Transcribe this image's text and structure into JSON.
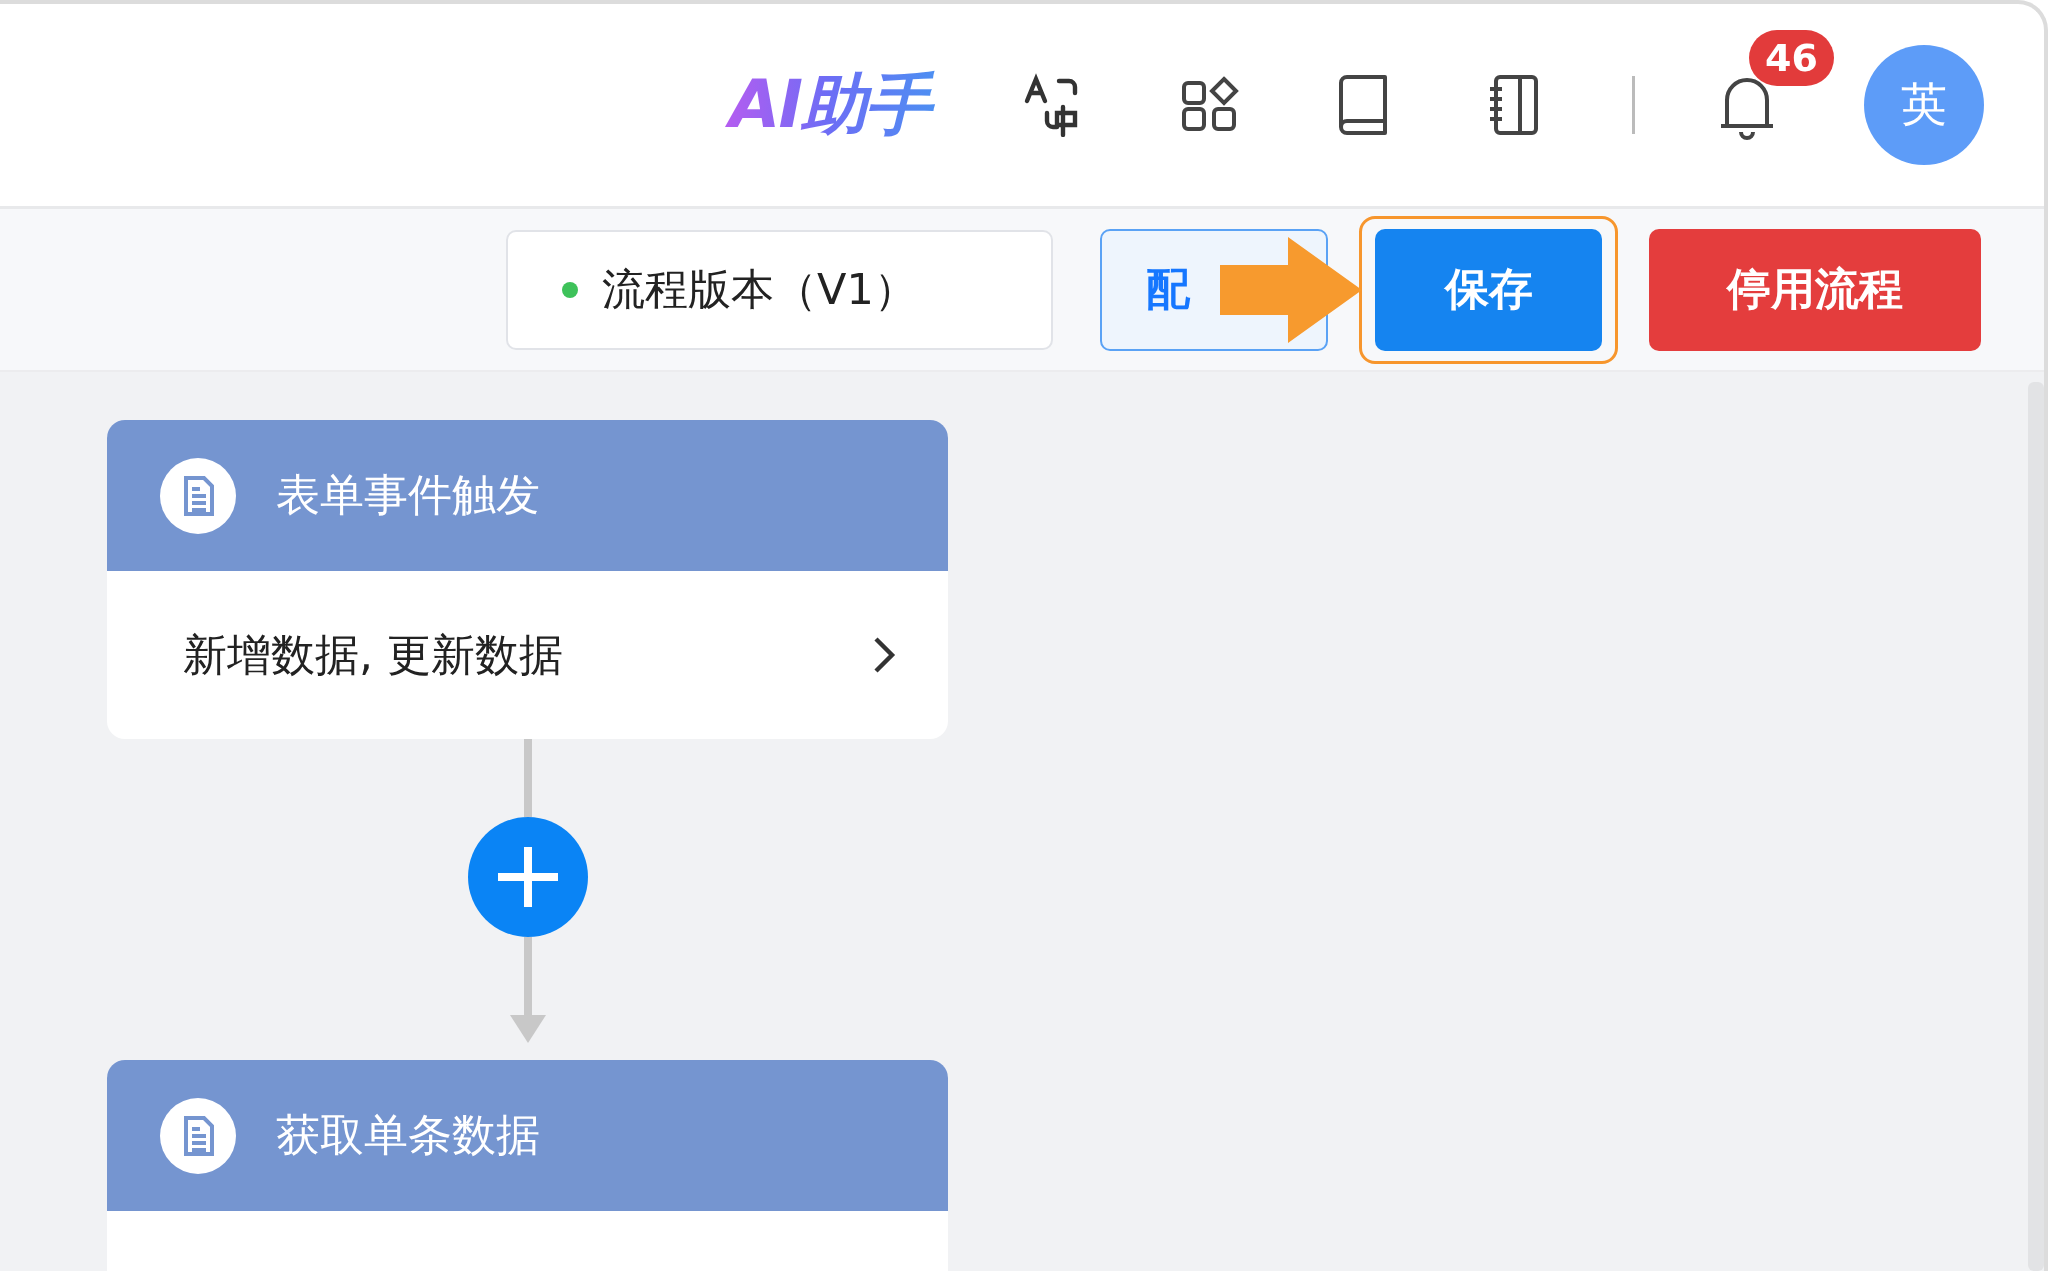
{
  "header": {
    "logo": "AI助手",
    "notifications": {
      "badge": "46"
    },
    "avatar": "英"
  },
  "toolbar": {
    "version": {
      "label": "流程版本（V1）",
      "published": true
    },
    "buttons": [
      {
        "label": "配",
        "kind": "secondary",
        "highlighted": false
      },
      {
        "label": "保存",
        "kind": "primary",
        "highlighted": true
      },
      {
        "label": "停用流程",
        "kind": "danger",
        "highlighted": false
      }
    ]
  },
  "flow": {
    "nodes": [
      {
        "title": "表单事件触发",
        "summary": "新增数据, 更新数据"
      },
      {
        "title": "获取单条数据"
      }
    ]
  }
}
